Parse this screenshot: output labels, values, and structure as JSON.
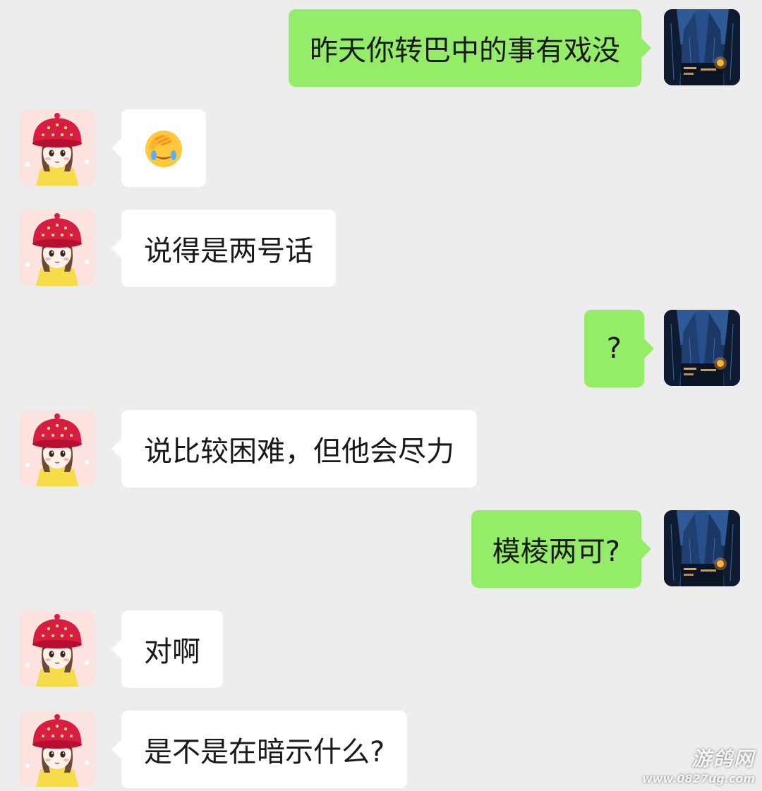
{
  "messages": [
    {
      "side": "out",
      "type": "text",
      "text": "昨天你转巴中的事有戏没"
    },
    {
      "side": "in",
      "type": "emoji",
      "text": "",
      "emoji": "facepalm-emoji"
    },
    {
      "side": "in",
      "type": "text",
      "text": "说得是两号话"
    },
    {
      "side": "out",
      "type": "text",
      "text": "?"
    },
    {
      "side": "in",
      "type": "text",
      "text": "说比较困难，但他会尽力"
    },
    {
      "side": "out",
      "type": "text",
      "text": "模棱两可?"
    },
    {
      "side": "in",
      "type": "text",
      "text": "对啊"
    },
    {
      "side": "in",
      "type": "text",
      "text": "是不是在暗示什么?"
    }
  ],
  "avatars": {
    "self": "city-night-avatar",
    "contact": "girl-red-hat-avatar"
  },
  "colors": {
    "background": "#ededed",
    "outgoing_bubble": "#95ec69",
    "incoming_bubble": "#ffffff",
    "text": "#191919"
  },
  "watermark": {
    "name": "游鸽网",
    "url": "www.0827ug.com"
  }
}
